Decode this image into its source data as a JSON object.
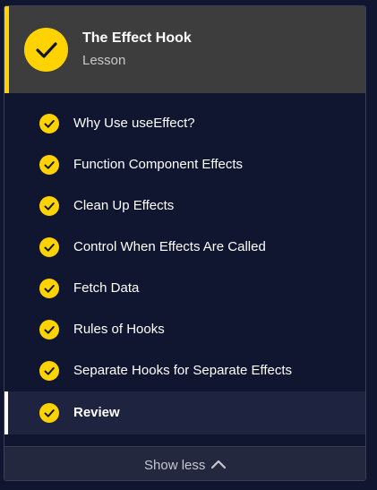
{
  "header": {
    "title": "The Effect Hook",
    "subtitle": "Lesson",
    "status_icon": "check-circle-icon"
  },
  "lessons": [
    {
      "label": "Why Use useEffect?",
      "completed": true,
      "active": false
    },
    {
      "label": "Function Component Effects",
      "completed": true,
      "active": false
    },
    {
      "label": "Clean Up Effects",
      "completed": true,
      "active": false
    },
    {
      "label": "Control When Effects Are Called",
      "completed": true,
      "active": false
    },
    {
      "label": "Fetch Data",
      "completed": true,
      "active": false
    },
    {
      "label": "Rules of Hooks",
      "completed": true,
      "active": false
    },
    {
      "label": "Separate Hooks for Separate Effects",
      "completed": true,
      "active": false
    },
    {
      "label": "Review",
      "completed": true,
      "active": true
    }
  ],
  "footer": {
    "toggle_label": "Show less",
    "toggle_icon": "chevron-up-icon"
  },
  "colors": {
    "accent": "#ffd300",
    "background": "#10162f",
    "header_bg": "#3d3d3d",
    "active_row": "#1e2340"
  }
}
